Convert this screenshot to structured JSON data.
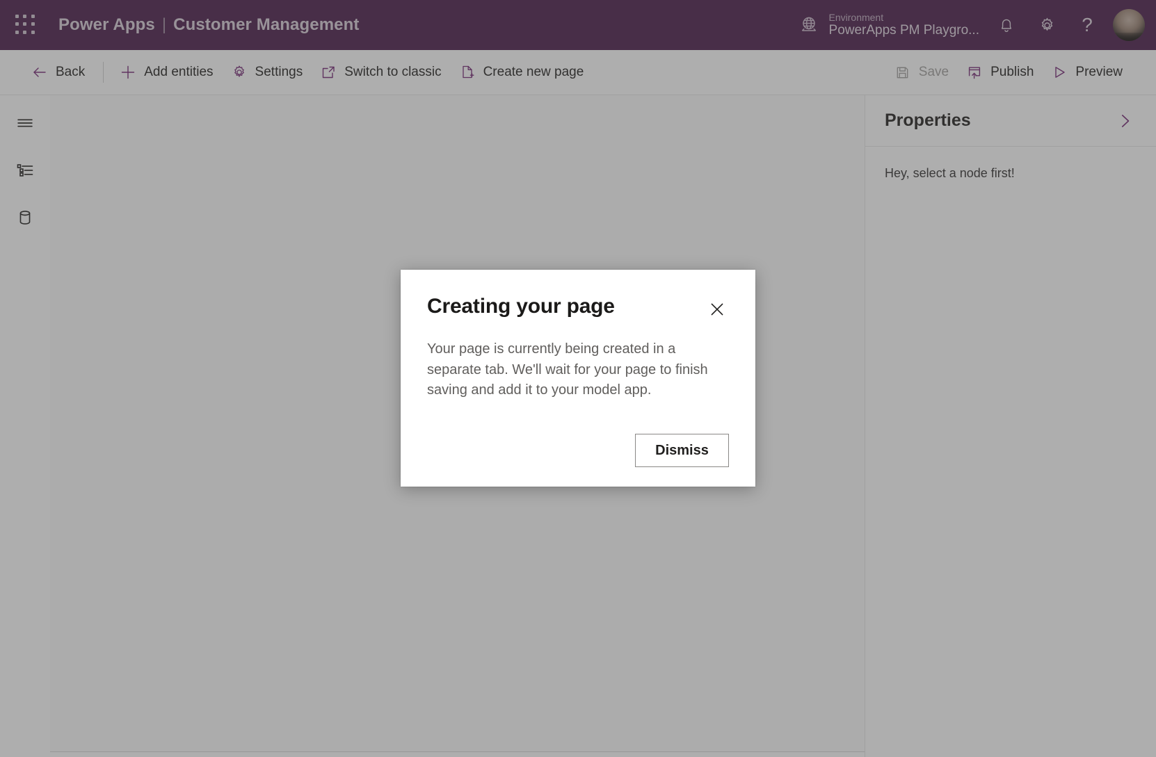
{
  "header": {
    "waffle_icon": "app-launcher-waffle-icon",
    "brand": "Power Apps",
    "separator": "|",
    "app_name": "Customer Management",
    "environment_label": "Environment",
    "environment_value": "PowerApps PM Playgro...",
    "globe_icon": "globe-icon",
    "notification_icon": "bell-icon",
    "settings_icon": "gear-icon",
    "help_icon": "question-mark-icon",
    "help_glyph": "?",
    "avatar_icon": "user-avatar"
  },
  "commandbar": {
    "back": "Back",
    "add_entities": "Add entities",
    "settings": "Settings",
    "switch_to_classic": "Switch to classic",
    "create_new_page": "Create new page",
    "save": "Save",
    "save_enabled": false,
    "publish": "Publish",
    "preview": "Preview"
  },
  "rail": {
    "items": [
      {
        "name": "menu-hamburger",
        "label": "Menu"
      },
      {
        "name": "tree-view",
        "label": "Tree view"
      },
      {
        "name": "data-entities",
        "label": "Data"
      }
    ]
  },
  "properties": {
    "title": "Properties",
    "collapse_icon": "chevron-right-icon",
    "empty_message": "Hey, select a node first!"
  },
  "dialog": {
    "title": "Creating your page",
    "close_icon": "close-x-icon",
    "body": "Your page is currently being created in a separate tab. We'll wait for your page to finish saving and add it to your model app.",
    "dismiss_label": "Dismiss"
  },
  "colors": {
    "brand_purple": "#4a1b4a",
    "accent_purple": "#742774",
    "overlay": "#919191",
    "text_primary": "#201f1e",
    "text_secondary": "#605e5c",
    "disabled": "#a19f9d"
  }
}
